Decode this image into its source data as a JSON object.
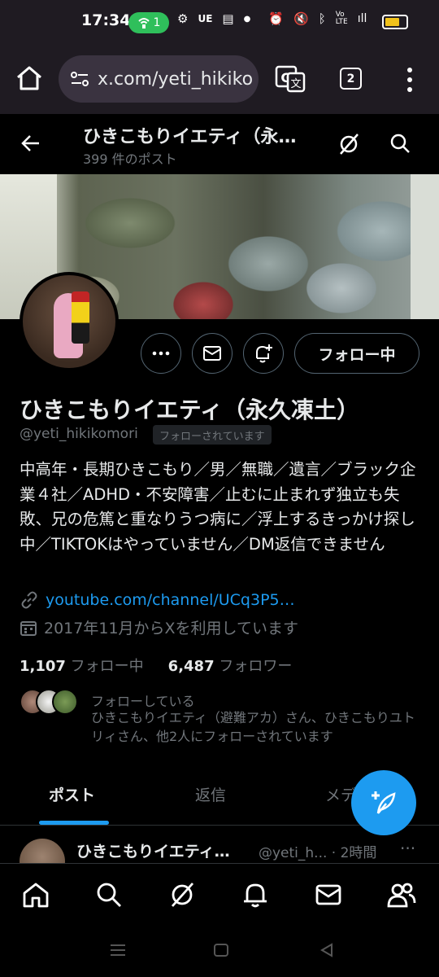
{
  "status_bar": {
    "time": "17:34",
    "hotspot_count": "1",
    "battery_level": 0.7,
    "accent_hotspot": "#2fbf5b"
  },
  "browser": {
    "url": "x.com/yeti_hikiko",
    "tab_count": "2"
  },
  "header": {
    "title": "ひきこもりイエティ（永…",
    "post_count": "399 件のポスト"
  },
  "profile": {
    "display_name": "ひきこもりイエティ（永久凍土）",
    "handle": "@yeti_hikikomori",
    "follows_you_badge": "フォローされています",
    "follow_button": "フォロー中",
    "bio": "中高年・長期ひきこもり／男／無職／遺言／ブラック企業４社／ADHD・不安障害／止むに止まれず独立も失敗、兄の危篤と重なりうつ病に／浮上するきっかけ探し中／TIKTOKはやっていません／DM返信できません",
    "link": "youtube.com/channel/UCq3P5…",
    "joined": "2017年11月からXを利用しています",
    "following_count": "1,107",
    "following_label": "フォロー中",
    "followers_count": "6,487",
    "followers_label": "フォロワー",
    "followed_by_title": "フォローしている",
    "followed_by_text": "ひきこもりイエティ（避難アカ）さん、ひきこもりユトリィさん、他2人にフォローされています"
  },
  "tabs": [
    {
      "label": "ポスト",
      "active": true
    },
    {
      "label": "返信",
      "active": false
    },
    {
      "label": "メディ",
      "active": false
    }
  ],
  "post_preview": {
    "name": "ひきこもりイエティ…",
    "handle": "@yeti_h... · 2時間",
    "more": "···"
  },
  "colors": {
    "accent": "#1d9bf0",
    "background": "#000000",
    "secondary_text": "#71767b",
    "primary_text": "#e7e9ea"
  },
  "icons": [
    "home-icon",
    "search-icon",
    "grok-icon",
    "bell-icon",
    "mail-icon",
    "people-icon",
    "compose-icon",
    "link-icon",
    "calendar-icon"
  ]
}
